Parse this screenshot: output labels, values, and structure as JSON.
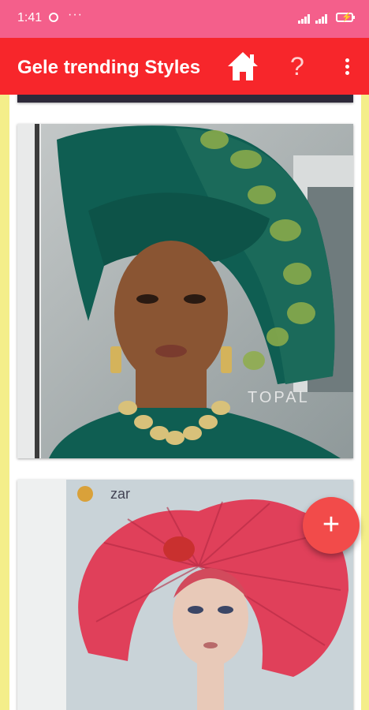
{
  "status_bar": {
    "time": "1:41",
    "more": "···"
  },
  "app_bar": {
    "title": "Gele trending Styles"
  },
  "feed": {
    "items": [
      {
        "watermark": "TOPAL"
      },
      {
        "watermark": "zar"
      }
    ]
  },
  "fab": {
    "label": "+"
  },
  "colors": {
    "status_bar": "#f45f8b",
    "app_bar": "#f7262b",
    "fab": "#f24b4a",
    "side_bg": "#f4ee8a"
  }
}
